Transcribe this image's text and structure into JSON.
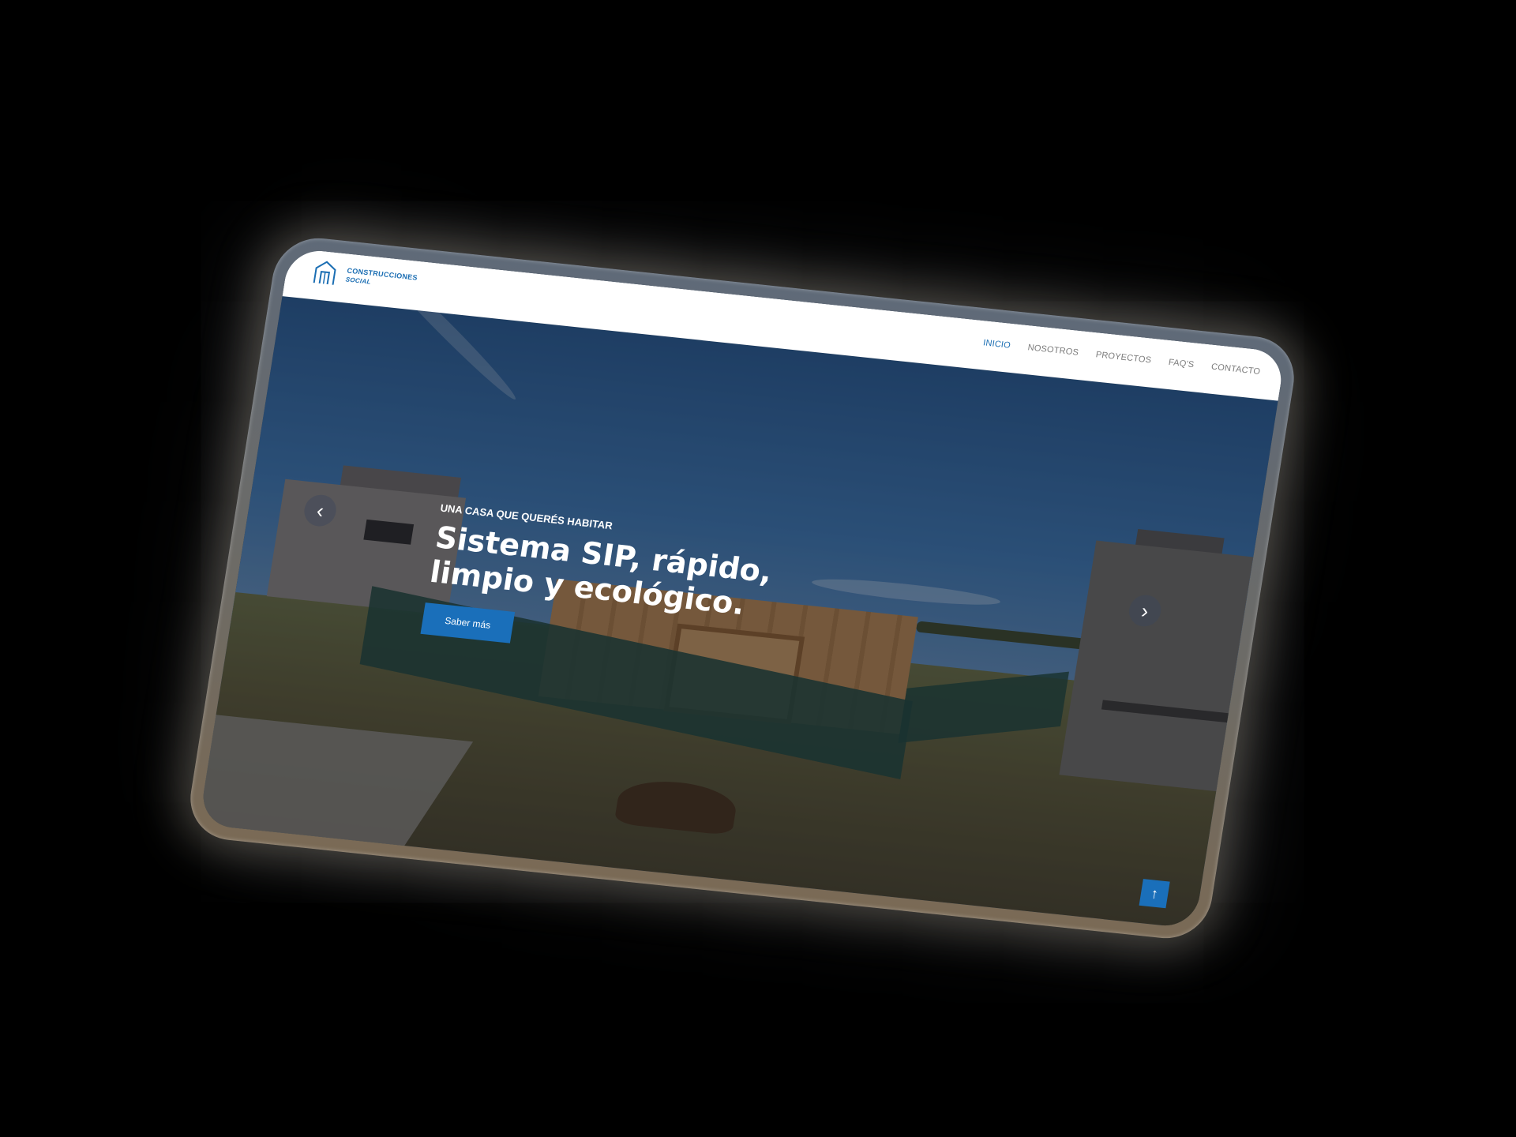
{
  "header": {
    "logo": {
      "name": "CONSTRUCCIONES",
      "sub": "SOCIAL"
    },
    "nav": [
      {
        "label": "INICIO",
        "active": true
      },
      {
        "label": "NOSOTROS",
        "active": false
      },
      {
        "label": "PROYECTOS",
        "active": false
      },
      {
        "label": "FAQ'S",
        "active": false
      },
      {
        "label": "CONTACTO",
        "active": false
      }
    ]
  },
  "hero": {
    "kicker": "UNA CASA QUE QUERÉS HABITAR",
    "headline": "Sistema SIP, rápido, limpio y ecológico.",
    "cta_label": "Saber más"
  },
  "controls": {
    "prev_icon": "chevron-left-icon",
    "next_icon": "chevron-right-icon",
    "back_to_top_icon": "arrow-up-icon"
  },
  "colors": {
    "brand": "#1a6fba",
    "nav_inactive": "#7a7a7a",
    "header_bg": "#ffffff",
    "page_bg": "#000000"
  }
}
